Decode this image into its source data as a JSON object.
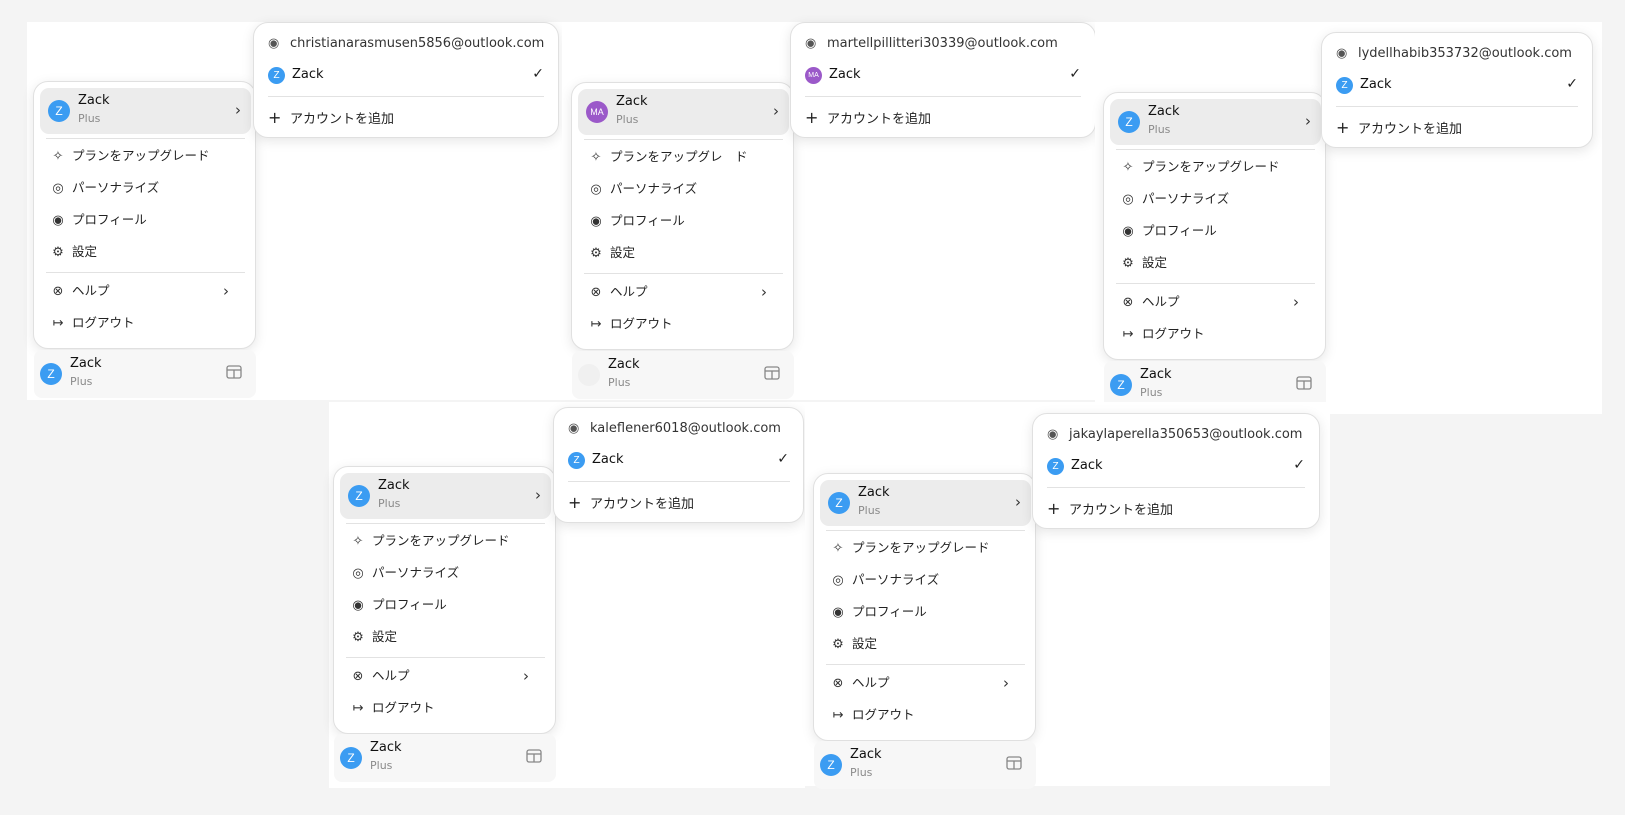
{
  "panels": [
    {
      "menu": {
        "user": {
          "name": "Zack",
          "plan": "Plus",
          "avatar_text": "Z",
          "avatar_color": "#3b9cf2"
        },
        "items": [
          {
            "label": "プランをアップグレード",
            "icon": "sparkle-icon"
          },
          {
            "label": "パーソナライズ",
            "icon": "personalize-icon"
          },
          {
            "label": "プロフィール",
            "icon": "user-circle-icon"
          },
          {
            "label": "設定",
            "icon": "gear-icon"
          }
        ],
        "help": "ヘルプ",
        "logout": "ログアウト"
      },
      "footer": {
        "name": "Zack",
        "plan": "Plus",
        "avatar_text": "Z",
        "avatar_color": "#3b9cf2"
      },
      "account": {
        "email": "christianarasmusen5856@outlook.com",
        "name": "Zack",
        "avatar_text": "Z",
        "avatar_color": "#3b9cf2",
        "add": "アカウントを追加"
      }
    },
    {
      "menu": {
        "user": {
          "name": "Zack",
          "plan": "Plus",
          "avatar_text": "MA",
          "avatar_color": "#9b59c9"
        },
        "items": [
          {
            "label": "プランをアップグレ　ド",
            "icon": "sparkle-icon"
          },
          {
            "label": "パーソナライズ",
            "icon": "personalize-icon"
          },
          {
            "label": "プロフィール",
            "icon": "user-circle-icon"
          },
          {
            "label": "設定",
            "icon": "gear-icon"
          }
        ],
        "help": "ヘルプ",
        "logout": "ログアウト"
      },
      "footer": {
        "name": "Zack",
        "plan": "Plus",
        "avatar_text": "",
        "avatar_color": "#f0f0f0"
      },
      "account": {
        "email": "martellpillitteri30339@outlook.com",
        "name": "Zack",
        "avatar_text": "MA",
        "avatar_color": "#9b59c9",
        "add": "アカウントを追加"
      }
    },
    {
      "menu": {
        "user": {
          "name": "Zack",
          "plan": "Plus",
          "avatar_text": "Z",
          "avatar_color": "#3b9cf2"
        },
        "items": [
          {
            "label": "プランをアップグレード",
            "icon": "sparkle-icon"
          },
          {
            "label": "パーソナライズ",
            "icon": "personalize-icon"
          },
          {
            "label": "プロフィール",
            "icon": "user-circle-icon"
          },
          {
            "label": "設定",
            "icon": "gear-icon"
          }
        ],
        "help": "ヘルプ",
        "logout": "ログアウト"
      },
      "footer": {
        "name": "Zack",
        "plan": "Plus",
        "avatar_text": "Z",
        "avatar_color": "#3b9cf2"
      },
      "account": {
        "email": "lydellhabib353732@outlook.com",
        "name": "Zack",
        "avatar_text": "Z",
        "avatar_color": "#3b9cf2",
        "add": "アカウントを追加"
      }
    },
    {
      "menu": {
        "user": {
          "name": "Zack",
          "plan": "Plus",
          "avatar_text": "Z",
          "avatar_color": "#3b9cf2"
        },
        "items": [
          {
            "label": "プランをアップグレード",
            "icon": "sparkle-icon"
          },
          {
            "label": "パーソナライズ",
            "icon": "personalize-icon"
          },
          {
            "label": "プロフィール",
            "icon": "user-circle-icon"
          },
          {
            "label": "設定",
            "icon": "gear-icon"
          }
        ],
        "help": "ヘルプ",
        "logout": "ログアウト"
      },
      "footer": {
        "name": "Zack",
        "plan": "Plus",
        "avatar_text": "Z",
        "avatar_color": "#3b9cf2"
      },
      "account": {
        "email": "kaleflener6018@outlook.com",
        "name": "Zack",
        "avatar_text": "Z",
        "avatar_color": "#3b9cf2",
        "add": "アカウントを追加"
      }
    },
    {
      "menu": {
        "user": {
          "name": "Zack",
          "plan": "Plus",
          "avatar_text": "Z",
          "avatar_color": "#3b9cf2"
        },
        "items": [
          {
            "label": "プランをアップグレード",
            "icon": "sparkle-icon"
          },
          {
            "label": "パーソナライズ",
            "icon": "personalize-icon"
          },
          {
            "label": "プロフィール",
            "icon": "user-circle-icon"
          },
          {
            "label": "設定",
            "icon": "gear-icon"
          }
        ],
        "help": "ヘルプ",
        "logout": "ログアウト"
      },
      "footer": {
        "name": "Zack",
        "plan": "Plus",
        "avatar_text": "Z",
        "avatar_color": "#3b9cf2"
      },
      "account": {
        "email": "jakaylaperella350653@outlook.com",
        "name": "Zack",
        "avatar_text": "Z",
        "avatar_color": "#3b9cf2",
        "add": "アカウントを追加"
      }
    }
  ]
}
